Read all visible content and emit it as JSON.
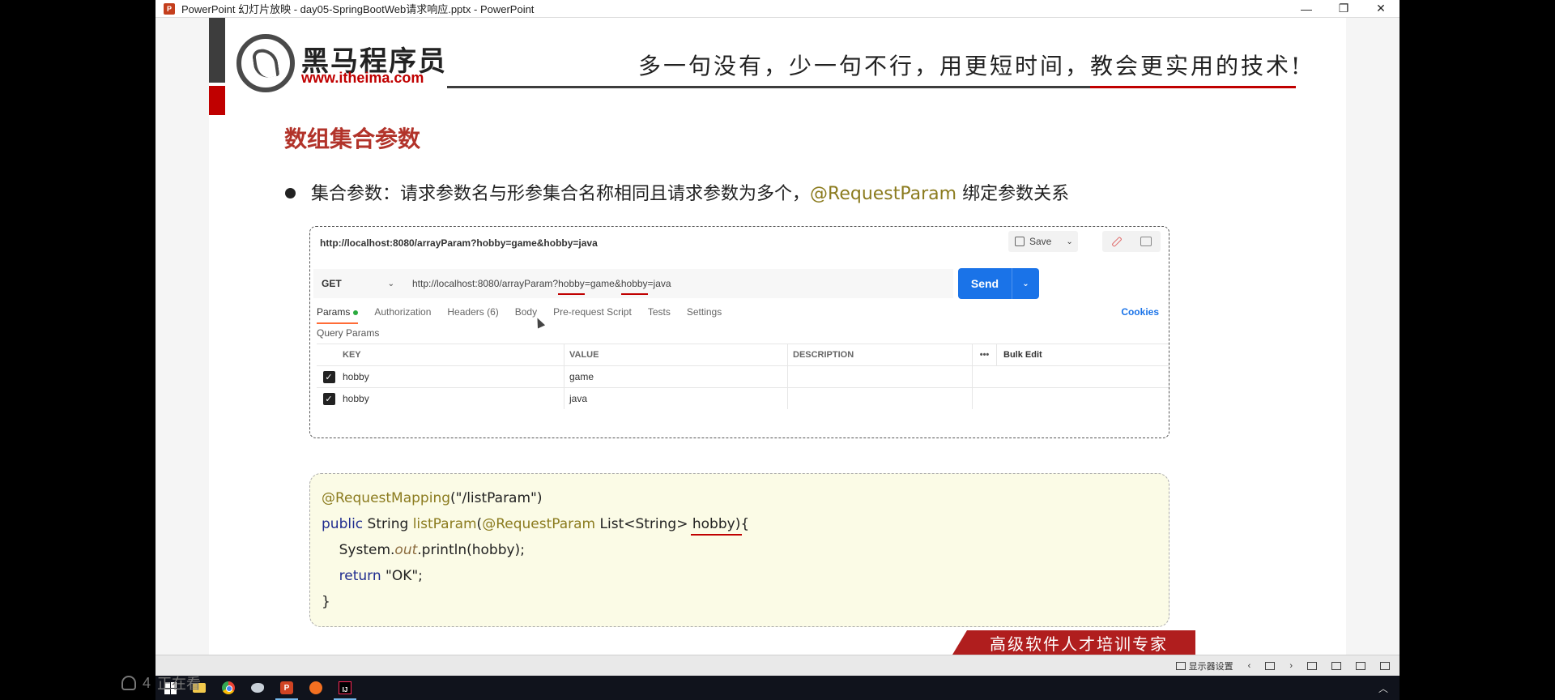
{
  "window": {
    "title": "PowerPoint 幻灯片放映  -  day05-SpringBootWeb请求响应.pptx - PowerPoint",
    "minimize": "—",
    "restore": "❐",
    "close": "✕"
  },
  "slide": {
    "brand_cn": "黑马程序员",
    "brand_url": "www.itheima.com",
    "slogan": "多一句没有，少一句不行，用更短时间，教会更实用的技术!",
    "title": "数组集合参数",
    "bullet_prefix": "集合参数：请求参数名与形参集合名称相同且请求参数为多个，",
    "bullet_annotation": "@RequestParam",
    "bullet_suffix": " 绑定参数关系",
    "banner": "高级软件人才培训专家"
  },
  "postman": {
    "tab_url": "http://localhost:8080/arrayParam?hobby=game&hobby=java",
    "save_label": "Save",
    "method": "GET",
    "url_prefix": "http://localhost:8080/arrayParam?",
    "url_key1": "hobby",
    "url_mid": "=game&",
    "url_key2": "hobby",
    "url_suffix": "=java",
    "send_label": "Send",
    "tabs": [
      "Params",
      "Authorization",
      "Headers (6)",
      "Body",
      "Pre-request Script",
      "Tests",
      "Settings"
    ],
    "cookies_label": "Cookies",
    "query_params_label": "Query Params",
    "table": {
      "headers": {
        "key": "KEY",
        "value": "VALUE",
        "description": "DESCRIPTION",
        "more": "•••",
        "bulk": "Bulk Edit"
      },
      "rows": [
        {
          "checked": "✓",
          "key": "hobby",
          "value": "game",
          "description": ""
        },
        {
          "checked": "✓",
          "key": "hobby",
          "value": "java",
          "description": ""
        }
      ]
    }
  },
  "code": {
    "l1_ann": "@RequestMapping",
    "l1_rest": "(\"/listParam\")",
    "l2_kw": "public",
    "l2_type": " String ",
    "l2_fn": "listParam",
    "l2_paren": "(",
    "l2_ann": "@RequestParam",
    "l2_generic": " List<String> ",
    "l2_param": "hobby",
    "l2_end": "){",
    "l3_a": "    System.",
    "l3_out": "out",
    "l3_b": ".println(hobby);",
    "l4_kw": "    return",
    "l4_rest": " \"OK\";",
    "l5": "}"
  },
  "statusbar": {
    "display_settings": "显示器设置"
  },
  "viewers": {
    "count": "4",
    "label": "正在看"
  }
}
